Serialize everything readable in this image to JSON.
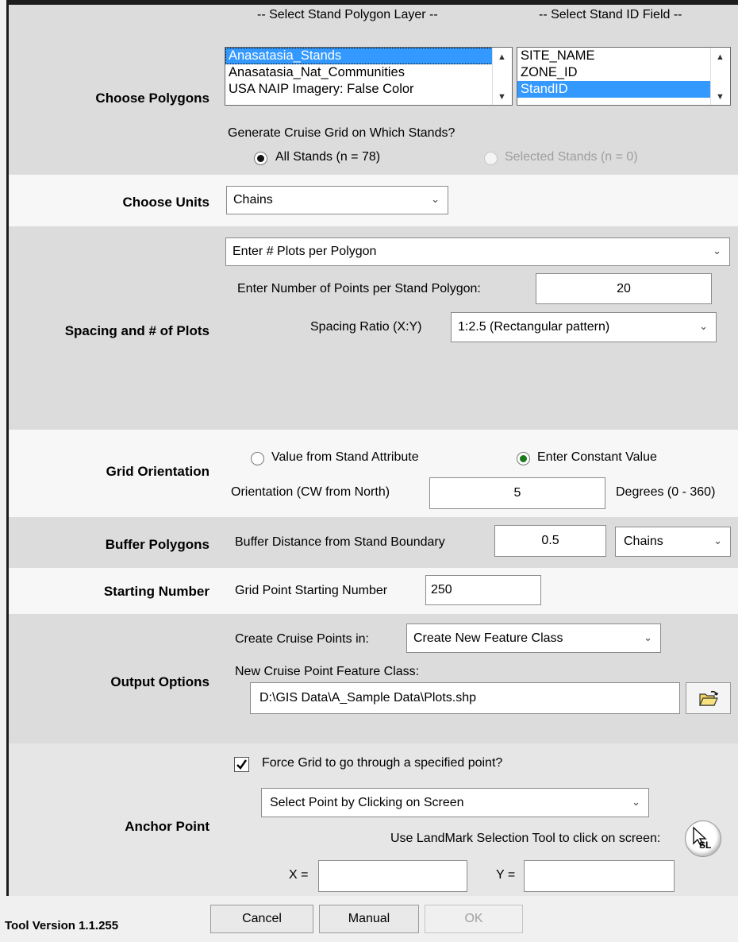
{
  "polygons": {
    "label": "Choose Polygons",
    "layer_header": "-- Select Stand Polygon Layer --",
    "field_header": "-- Select Stand ID Field --",
    "layers": [
      "Anasatasia_Stands",
      "Anasatasia_Nat_Communities",
      "USA NAIP Imagery: False Color"
    ],
    "fields": [
      "SITE_NAME",
      "ZONE_ID",
      "StandID"
    ],
    "generate_question": "Generate Cruise Grid on Which Stands?",
    "all_stands": "All Stands (n = 78)",
    "selected_stands": "Selected Stands (n = 0)"
  },
  "units": {
    "label": "Choose Units",
    "value": "Chains"
  },
  "spacing": {
    "label": "Spacing and # of Plots",
    "method": "Enter # Plots per Polygon",
    "points_label": "Enter Number of Points per Stand Polygon:",
    "points_value": "20",
    "ratio_label": "Spacing Ratio (X:Y)",
    "ratio_value": "1:2.5 (Rectangular pattern)"
  },
  "orientation": {
    "label": "Grid Orientation",
    "opt_attribute": "Value from Stand Attribute",
    "opt_constant": "Enter Constant Value",
    "field_label": "Orientation (CW from North)",
    "value": "5",
    "units": "Degrees (0 - 360)"
  },
  "buffer": {
    "label": "Buffer Polygons",
    "field_label": "Buffer Distance from Stand Boundary",
    "value": "0.5",
    "units": "Chains"
  },
  "start": {
    "label": "Starting Number",
    "field_label": "Grid Point Starting Number",
    "value": "250"
  },
  "output": {
    "label": "Output Options",
    "create_label": "Create Cruise Points in:",
    "create_value": "Create New Feature Class",
    "class_label": "New Cruise Point Feature Class:",
    "path": "D:\\GIS Data\\A_Sample Data\\Plots.shp"
  },
  "anchor": {
    "label": "Anchor Point",
    "force_label": "Force Grid to go through a specified point?",
    "method": "Select Point by Clicking on Screen",
    "tool_label": "Use LandMark Selection Tool to click on screen:",
    "x_label": "X =",
    "y_label": "Y =",
    "x_value": "",
    "y_value": "",
    "tool_icon_text": "SL"
  },
  "footer": {
    "version": "Tool Version 1.1.255",
    "cancel": "Cancel",
    "manual": "Manual",
    "ok": "OK"
  },
  "colors": {
    "selection": "#3399ff",
    "radio_on": "#1b7a1b"
  }
}
